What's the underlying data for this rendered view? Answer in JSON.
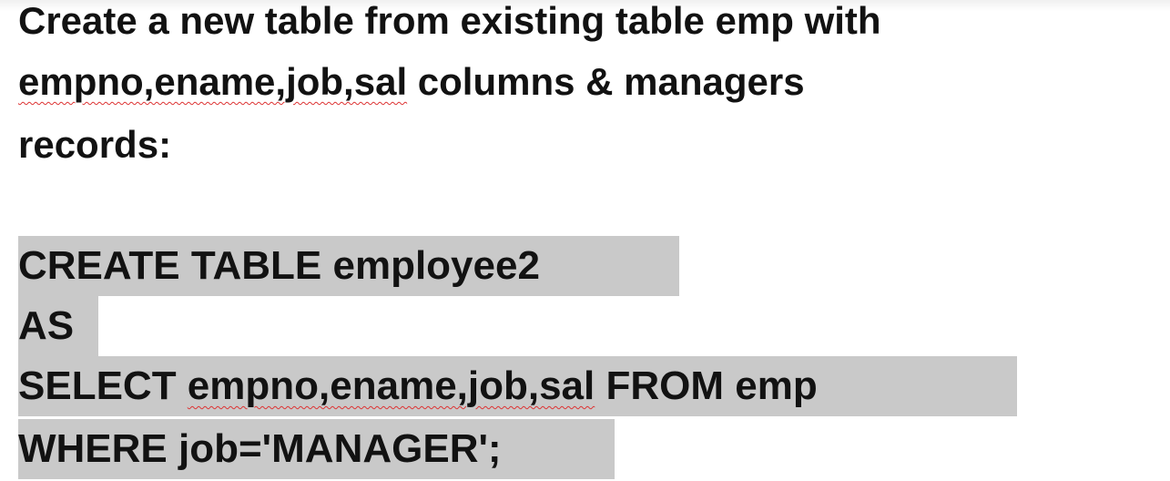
{
  "heading": {
    "line1": "Create a new table from existing table emp with",
    "line2_columns": "empno,ename,job,sal",
    "line2_rest": " columns & managers",
    "line3": "records:"
  },
  "sql": {
    "line1": "CREATE TABLE employee2",
    "line2": "AS",
    "line3_keyword": "SELECT ",
    "line3_columns": "empno,ename,job,sal",
    "line3_rest": " FROM emp",
    "line4": "WHERE job='MANAGER';"
  }
}
